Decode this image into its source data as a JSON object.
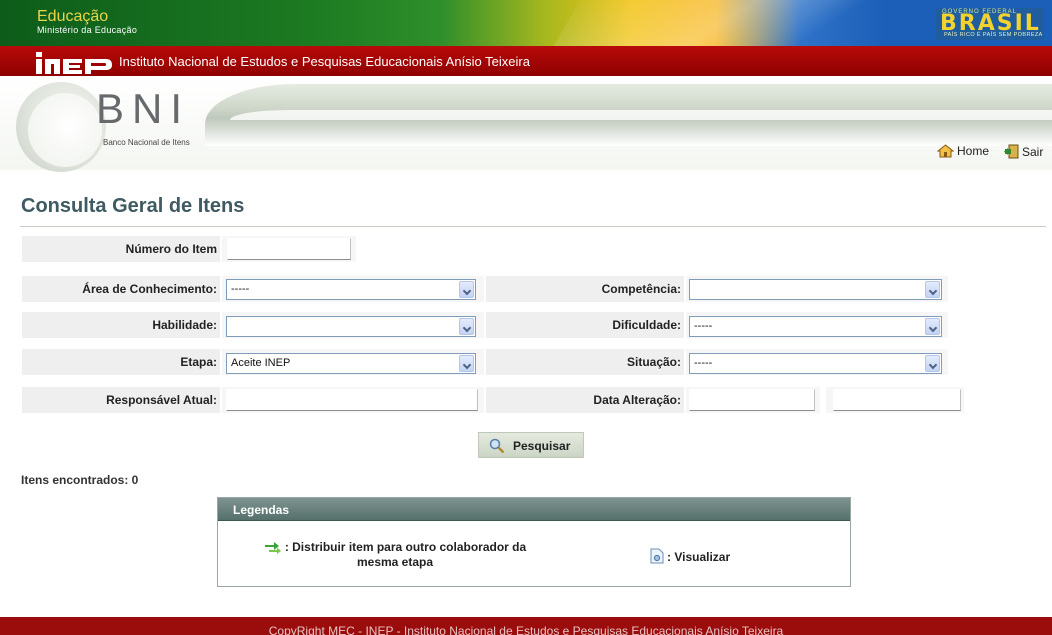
{
  "gov_banner": {
    "title": "Educação",
    "subtitle": "Ministério da Educação",
    "brasil_top": "GOVERNO FEDERAL",
    "brasil_word": "BRASIL",
    "brasil_slogan": "PAÍS RICO É PAÍS SEM POBREZA"
  },
  "inep": {
    "logo_text": "INEP",
    "name": "Instituto Nacional de Estudos e Pesquisas Educacionais Anísio Teixeira"
  },
  "bni": {
    "letters": "BNI",
    "caption": "Banco Nacional de Itens"
  },
  "top_nav": {
    "home_label": "Home",
    "sair_label": "Sair",
    "home_icon": "house-icon",
    "sair_icon": "exit-door-icon"
  },
  "page": {
    "title": "Consulta Geral de Itens"
  },
  "form": {
    "numero_item": {
      "label": "Número do Item",
      "value": ""
    },
    "area_conhecimento": {
      "label": "Área de Conhecimento:",
      "selected": "-----"
    },
    "competencia": {
      "label": "Competência:",
      "selected": ""
    },
    "habilidade": {
      "label": "Habilidade:",
      "selected": ""
    },
    "dificuldade": {
      "label": "Dificuldade:",
      "selected": "-----"
    },
    "etapa": {
      "label": "Etapa:",
      "selected": "Aceite INEP"
    },
    "situacao": {
      "label": "Situação:",
      "selected": "-----"
    },
    "responsavel_atual": {
      "label": "Responsável Atual:",
      "value": ""
    },
    "data_alteracao": {
      "label": "Data Alteração:",
      "from_value": "",
      "to_value": ""
    }
  },
  "search": {
    "label": "Pesquisar",
    "icon": "magnifier-icon"
  },
  "results": {
    "count_text": "Itens encontrados: 0"
  },
  "legend": {
    "title": "Legendas",
    "items": [
      {
        "icon": "distribute-arrows-icon",
        "text": ": Distribuir item para outro colaborador da mesma etapa"
      },
      {
        "icon": "view-document-icon",
        "text": ": Visualizar"
      }
    ]
  },
  "footer": {
    "text": "CopyRight MEC - INEP - Instituto Nacional de Estudos e Pesquisas Educacionais Anísio Teixeira"
  },
  "colors": {
    "gov_green": "#1d7b22",
    "inep_red": "#a00000",
    "title_color": "#3f5a62",
    "legend_header": "#6a817d",
    "footer_red": "#9b0d0d"
  }
}
